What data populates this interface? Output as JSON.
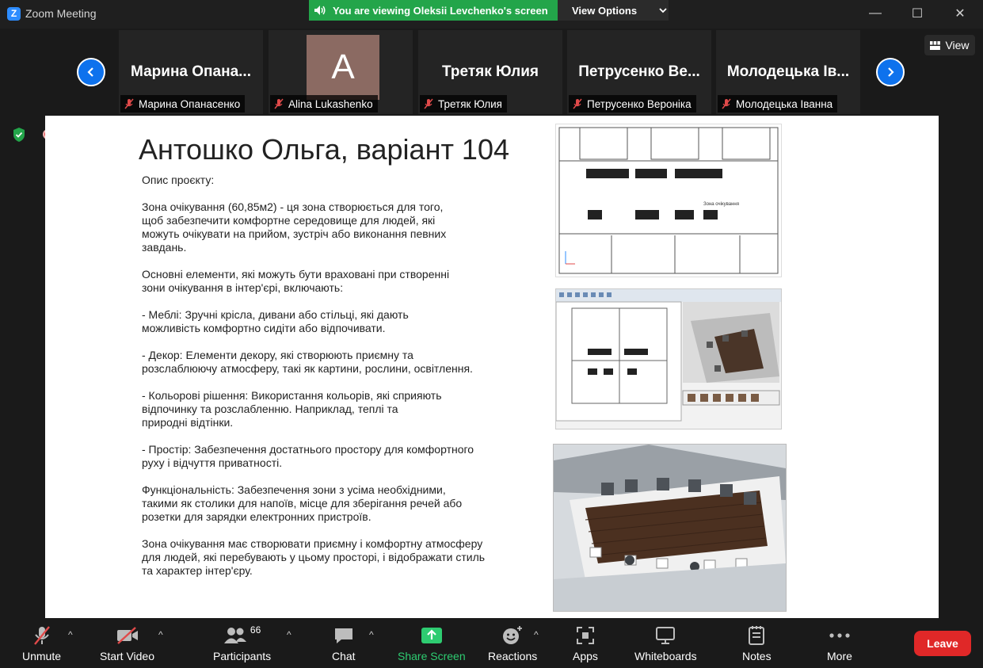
{
  "window": {
    "title": "Zoom Meeting",
    "minimize": "—",
    "maximize": "☐",
    "close": "✕"
  },
  "banner": {
    "viewing_text": "You are viewing Oleksii Levchenko's screen",
    "view_options": "View Options"
  },
  "gallery": {
    "view_label": "View",
    "tiles": [
      {
        "big_name": "Марина  Опана...",
        "label": "Марина Опанасенко"
      },
      {
        "avatar_letter": "A",
        "label": "Alina Lukashenko"
      },
      {
        "big_name": "Третяк Юлия",
        "label": "Третяк Юлия"
      },
      {
        "big_name": "Петрусенко  Ве...",
        "label": "Петрусенко Вероніка"
      },
      {
        "big_name": "Молодецька  Ів...",
        "label": "Молодецька Іванна"
      }
    ]
  },
  "slide": {
    "title": "Антошко Ольга, варіант 104",
    "paragraphs": [
      "Опис проєкту:",
      "Зона очікування (60,85м2) - ця зона створюється для того,\nщоб забезпечити комфортне середовище для людей, які\nможуть очікувати на прийом, зустріч або виконання певних\nзавдань.",
      "Основні елементи, які можуть бути враховані при створенні\nзони очікування в інтер'єрі, включають:",
      "- Меблі: Зручні крісла, дивани або стільці, які дають\nможливість комфортно сидіти або відпочивати.",
      "- Декор: Елементи декору, які створюють приємну та\nрозслаблюючу атмосферу, такі як картини, рослини, освітлення.",
      "- Кольорові рішення: Використання кольорів, які сприяють\nвідпочинку та розслабленню. Наприклад, теплі та\nприродні відтінки.",
      "- Простір: Забезпечення достатнього простору для комфортного\nруху і відчуття приватності.",
      "Функціональність: Забезпечення зони з усіма необхідними,\nтакими як столики для напоїв, місце для зберігання речей або\nрозетки для зарядки електронних пристроїв.",
      "Зона очікування має створювати приємну і комфортну атмосферу\nдля людей, які перебувають у цьому просторі, і відображати стиль\nта характер інтер'єру."
    ],
    "plan_label": "Зона очікування\n60,85 м²"
  },
  "toolbar": {
    "unmute": "Unmute",
    "start_video": "Start Video",
    "participants": "Participants",
    "participants_count": "66",
    "chat": "Chat",
    "share_screen": "Share Screen",
    "reactions": "Reactions",
    "apps": "Apps",
    "whiteboards": "Whiteboards",
    "notes": "Notes",
    "more": "More",
    "leave": "Leave"
  },
  "colors": {
    "zoom_blue": "#0e72ed",
    "banner_green": "#23a54a",
    "leave_red": "#e02828",
    "share_green": "#2ecc71"
  }
}
